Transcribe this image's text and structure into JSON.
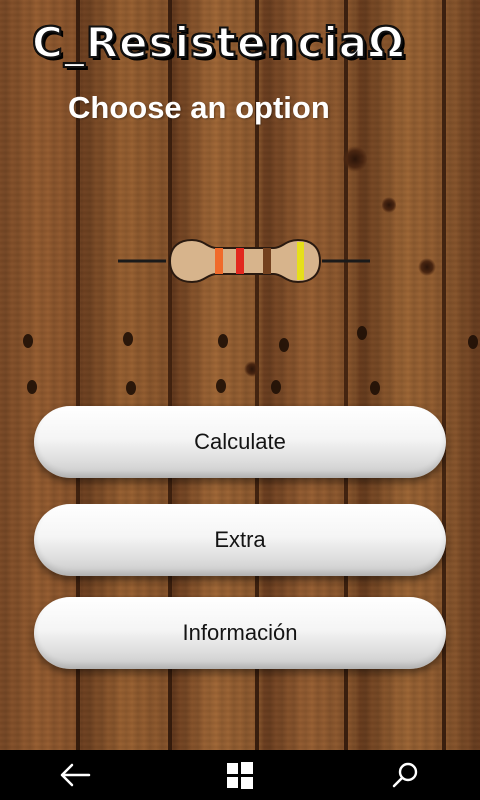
{
  "app": {
    "title": "C_ResistenciaΩ"
  },
  "screen": {
    "heading": "Choose an option"
  },
  "resistor_image": {
    "bands": [
      "#f06a2b",
      "#e2281f",
      "#73411f",
      "#e6df1a"
    ]
  },
  "menu": {
    "buttons": [
      {
        "label": "Calculate"
      },
      {
        "label": "Extra"
      },
      {
        "label": "Información"
      }
    ]
  },
  "taskbar": {
    "back_icon": "back-arrow-icon",
    "home_icon": "windows-logo-icon",
    "search_icon": "search-icon"
  },
  "colors": {
    "button_text": "#141414",
    "title_text": "#ffffff",
    "taskbar": "#000000"
  }
}
